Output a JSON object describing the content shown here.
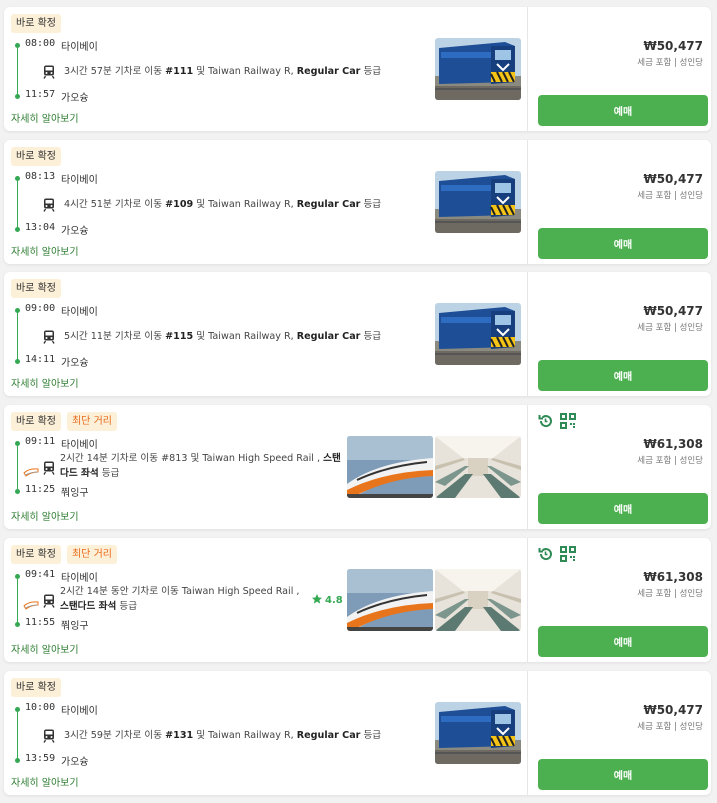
{
  "colors": {
    "accent": "#34a853",
    "button": "#4caf50",
    "badge_bg": "#fdf0d8",
    "short_text": "#e86a1b"
  },
  "results": [
    {
      "badges": [
        "바로 확정"
      ],
      "depart_time": "08:00",
      "depart_station": "타이베이",
      "arrive_time": "11:57",
      "arrive_station": "가오슝",
      "trip_pre": "3시간 57분 기차로 이동",
      "train_no": "#111",
      "trip_mid": "및 Taiwan Railway R,",
      "car_class": "Regular Car",
      "trip_post": "등급",
      "more": "자세히 알아보기",
      "price": "₩50,477",
      "tax": "세금 포함 | 성인당",
      "book": "예매",
      "type": "rail"
    },
    {
      "badges": [
        "바로 확정"
      ],
      "depart_time": "08:13",
      "depart_station": "타이베이",
      "arrive_time": "13:04",
      "arrive_station": "가오슝",
      "trip_pre": "4시간 51분 기차로 이동",
      "train_no": "#109",
      "trip_mid": "및 Taiwan Railway R,",
      "car_class": "Regular Car",
      "trip_post": "등급",
      "more": "자세히 알아보기",
      "price": "₩50,477",
      "tax": "세금 포함 | 성인당",
      "book": "예매",
      "type": "rail"
    },
    {
      "badges": [
        "바로 확정"
      ],
      "depart_time": "09:00",
      "depart_station": "타이베이",
      "arrive_time": "14:11",
      "arrive_station": "가오슝",
      "trip_pre": "5시간 11분 기차로 이동",
      "train_no": "#115",
      "trip_mid": "및 Taiwan Railway R,",
      "car_class": "Regular Car",
      "trip_post": "등급",
      "more": "자세히 알아보기",
      "price": "₩50,477",
      "tax": "세금 포함 | 성인당",
      "book": "예매",
      "type": "rail"
    },
    {
      "badges": [
        "바로 확정",
        "최단 거리"
      ],
      "depart_time": "09:11",
      "depart_station": "타이베이",
      "arrive_time": "11:25",
      "arrive_station": "쭤잉구",
      "trip_line1": "2시간 14분 기차로 이동 #813 및 Taiwan High Speed Rail ,",
      "trip_line1_bold": "스탠",
      "trip_line2_bold": "다드 좌석",
      "trip_line2": "등급",
      "more": "자세히 알아보기",
      "price": "₩61,308",
      "tax": "세금 포함 | 성인당",
      "book": "예매",
      "type": "hsr"
    },
    {
      "badges": [
        "바로 확정",
        "최단 거리"
      ],
      "depart_time": "09:41",
      "depart_station": "타이베이",
      "arrive_time": "11:55",
      "arrive_station": "쭤잉구",
      "trip_line1": "2시간 14분 동안 기차로 이동 Taiwan High Speed Rail ,",
      "trip_line1_bold": "",
      "trip_line2_bold": "스탠다드 좌석",
      "trip_line2": "등급",
      "rating": "4.8",
      "more": "자세히 알아보기",
      "price": "₩61,308",
      "tax": "세금 포함 | 성인당",
      "book": "예매",
      "type": "hsr"
    },
    {
      "badges": [
        "바로 확정"
      ],
      "depart_time": "10:00",
      "depart_station": "타이베이",
      "arrive_time": "13:59",
      "arrive_station": "가오슝",
      "trip_pre": "3시간 59분 기차로 이동",
      "train_no": "#131",
      "trip_mid": "및 Taiwan Railway R,",
      "car_class": "Regular Car",
      "trip_post": "등급",
      "more": "자세히 알아보기",
      "price": "₩50,477",
      "tax": "세금 포함 | 성인당",
      "book": "예매",
      "type": "rail"
    }
  ]
}
